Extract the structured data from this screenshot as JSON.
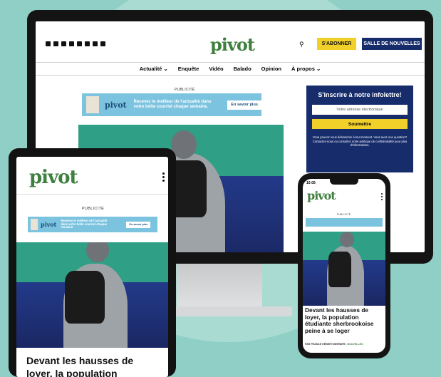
{
  "desktop": {
    "logo": "pivot",
    "subscribe_label": "S'ABONNER",
    "newsletter_label": "SALLE DE NOUVELLES",
    "nav": [
      "Actualité ⌄",
      "Enquête",
      "Vidéo",
      "Balado",
      "Opinion",
      "À propos ⌄"
    ],
    "pub_label": "PUBLICITÉ",
    "ad": {
      "logo": "pivot",
      "text": "Recevez le meilleur de l'actualité dans votre boîte courriel chaque semaine.",
      "button": "En savoir plus"
    },
    "newsletter": {
      "title": "S'inscrire à notre infolettre!",
      "placeholder": "Votre adresse électronique",
      "submit": "Soumettre",
      "note": "Vous pouvez vous désinscrire à tout moment. Vous avez une question? Contactez-nous ou consultez notre politique de confidentialité pour plus d'informations."
    }
  },
  "tablet": {
    "logo": "pivot",
    "pub_label": "PUBLICITÉ",
    "ad": {
      "logo": "pivot",
      "text": "Recevez le meilleur de l'actualité dans votre boîte courriel chaque semaine.",
      "button": "En savoir plus"
    },
    "headline": "Devant les hausses de loyer, la population étudiante"
  },
  "phone": {
    "time": "10:05",
    "logo": "pivot",
    "pub_label": "PUBLICITÉ",
    "headline": "Devant les hausses de loyer, la population étudiante sherbrookoise peine à se loger",
    "byline": "PAR FRANCE HÉBERT-BERNIER",
    "category": "NOUVELLES"
  },
  "colors": {
    "green": "#3f7f3f",
    "navy": "#162c6b",
    "yellow": "#f2d02a",
    "bg": "#8fcfc6"
  }
}
